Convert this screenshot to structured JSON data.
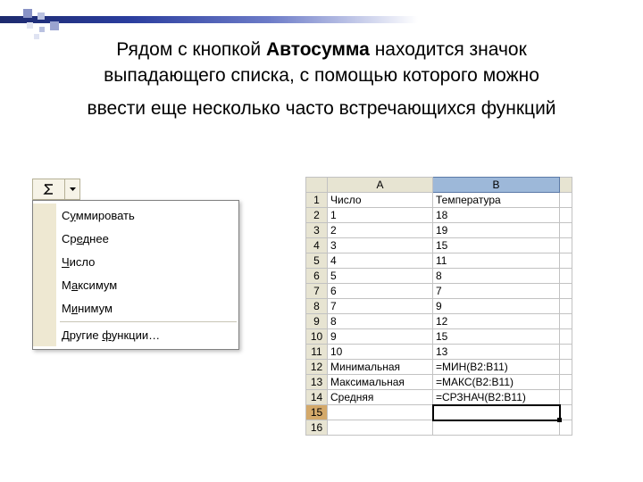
{
  "text": {
    "line1_pre": "Рядом с кнопкой ",
    "line1_bold": "Автосумма",
    "line1_post": " находится значок",
    "line2": "выпадающего списка, с помощью которого можно",
    "line3": "ввести еще несколько часто встречающихся функций"
  },
  "autosum_menu": {
    "items": [
      {
        "pre": "С",
        "mnem": "у",
        "post": "ммировать"
      },
      {
        "pre": "Ср",
        "mnem": "е",
        "post": "днее"
      },
      {
        "pre": "",
        "mnem": "Ч",
        "post": "исло"
      },
      {
        "pre": "М",
        "mnem": "а",
        "post": "ксимум"
      },
      {
        "pre": "М",
        "mnem": "и",
        "post": "нимум"
      }
    ],
    "more": {
      "pre": "Другие ",
      "mnem": "ф",
      "post": "ункции…"
    }
  },
  "sheet": {
    "col_headers": [
      "A",
      "B"
    ],
    "rows": [
      {
        "r": "1",
        "a": "Число",
        "b": "Температура"
      },
      {
        "r": "2",
        "a": "1",
        "b": "18"
      },
      {
        "r": "3",
        "a": "2",
        "b": "19"
      },
      {
        "r": "4",
        "a": "3",
        "b": "15"
      },
      {
        "r": "5",
        "a": "4",
        "b": "11"
      },
      {
        "r": "6",
        "a": "5",
        "b": "8"
      },
      {
        "r": "7",
        "a": "6",
        "b": "7"
      },
      {
        "r": "8",
        "a": "7",
        "b": "9"
      },
      {
        "r": "9",
        "a": "8",
        "b": "12"
      },
      {
        "r": "10",
        "a": "9",
        "b": "15"
      },
      {
        "r": "11",
        "a": "10",
        "b": "13"
      },
      {
        "r": "12",
        "a": "Минимальная",
        "b": "=МИН(B2:B11)"
      },
      {
        "r": "13",
        "a": "Максимальная",
        "b": "=МАКС(B2:B11)"
      },
      {
        "r": "14",
        "a": "Средняя",
        "b": "=СРЗНАЧ(B2:B11)"
      },
      {
        "r": "15",
        "a": "",
        "b": ""
      },
      {
        "r": "16",
        "a": "",
        "b": ""
      }
    ],
    "active_cell_index": 14,
    "selected_col": "B",
    "selected_row_hdr": "15"
  }
}
